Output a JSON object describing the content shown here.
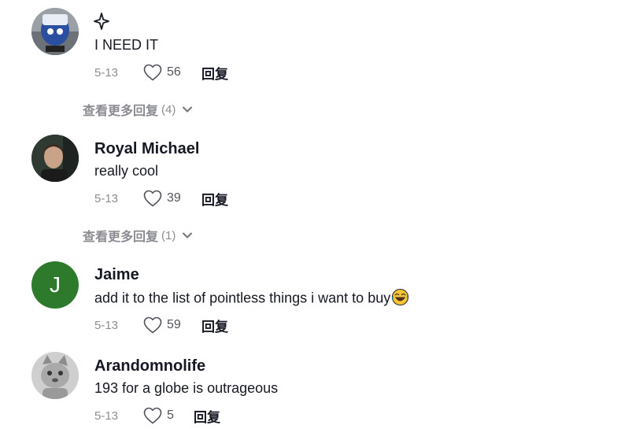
{
  "comments": [
    {
      "author": "",
      "has_sparkle": true,
      "text": "I NEED IT",
      "date": "5-13",
      "likes": "56",
      "reply_label": "回复",
      "avatar": "cartoon-image"
    },
    {
      "author": "Royal Michael",
      "text": "really cool",
      "date": "5-13",
      "likes": "39",
      "reply_label": "回复",
      "avatar": "photo-man"
    },
    {
      "author": "Jaime",
      "text": "add it to the list of pointless things i want to buy",
      "emoji": "laughing-tears-emoji",
      "date": "5-13",
      "likes": "59",
      "reply_label": "回复",
      "avatar_letter": "J",
      "avatar_color": "#2d7a2c"
    },
    {
      "author": "Arandomnolife",
      "text": "193 for a globe is outrageous",
      "date": "5-13",
      "likes": "5",
      "reply_label": "回复",
      "avatar": "cartoon-cat-grayscale"
    }
  ],
  "view_more": [
    {
      "label": "查看更多回复",
      "count": "(4)"
    },
    {
      "label": "查看更多回复",
      "count": "(1)"
    }
  ],
  "icons": {
    "like": "heart-outline-icon",
    "expand": "chevron-down-icon",
    "sparkle": "sparkle-icon"
  }
}
